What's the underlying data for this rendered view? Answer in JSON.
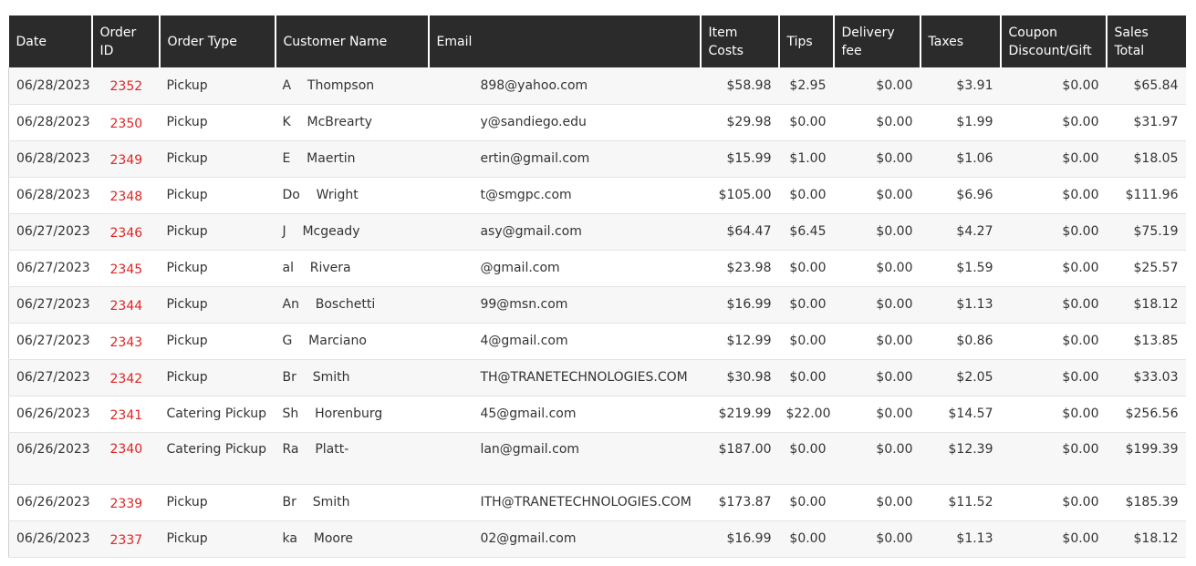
{
  "columns": [
    "Date",
    "Order ID",
    "Order Type",
    "Customer Name",
    "Email",
    "Item Costs",
    "Tips",
    "Delivery fee",
    "Taxes",
    "Coupon Discount/Gift",
    "Sales Total"
  ],
  "rows": [
    {
      "date": "06/28/2023",
      "id": "2352",
      "type": "Pickup",
      "name_a": "A",
      "name_b": "Thompson",
      "email_a": "",
      "email_b": "898@yahoo.com",
      "item": "$58.98",
      "tips": "$2.95",
      "fee": "$0.00",
      "taxes": "$3.91",
      "coupon": "$0.00",
      "total": "$65.84"
    },
    {
      "date": "06/28/2023",
      "id": "2350",
      "type": "Pickup",
      "name_a": "K",
      "name_b": "McBrearty",
      "email_a": "",
      "email_b": "y@sandiego.edu",
      "item": "$29.98",
      "tips": "$0.00",
      "fee": "$0.00",
      "taxes": "$1.99",
      "coupon": "$0.00",
      "total": "$31.97"
    },
    {
      "date": "06/28/2023",
      "id": "2349",
      "type": "Pickup",
      "name_a": "E",
      "name_b": "Maertin",
      "email_a": "",
      "email_b": "ertin@gmail.com",
      "item": "$15.99",
      "tips": "$1.00",
      "fee": "$0.00",
      "taxes": "$1.06",
      "coupon": "$0.00",
      "total": "$18.05"
    },
    {
      "date": "06/28/2023",
      "id": "2348",
      "type": "Pickup",
      "name_a": "Do",
      "name_b": "Wright",
      "email_a": "",
      "email_b": "t@smgpc.com",
      "item": "$105.00",
      "tips": "$0.00",
      "fee": "$0.00",
      "taxes": "$6.96",
      "coupon": "$0.00",
      "total": "$111.96"
    },
    {
      "date": "06/27/2023",
      "id": "2346",
      "type": "Pickup",
      "name_a": "J",
      "name_b": "Mcgeady",
      "email_a": "",
      "email_b": "asy@gmail.com",
      "item": "$64.47",
      "tips": "$6.45",
      "fee": "$0.00",
      "taxes": "$4.27",
      "coupon": "$0.00",
      "total": "$75.19"
    },
    {
      "date": "06/27/2023",
      "id": "2345",
      "type": "Pickup",
      "name_a": "al",
      "name_b": "Rivera",
      "email_a": "",
      "email_b": "@gmail.com",
      "item": "$23.98",
      "tips": "$0.00",
      "fee": "$0.00",
      "taxes": "$1.59",
      "coupon": "$0.00",
      "total": "$25.57"
    },
    {
      "date": "06/27/2023",
      "id": "2344",
      "type": "Pickup",
      "name_a": "An",
      "name_b": "Boschetti",
      "email_a": "",
      "email_b": "99@msn.com",
      "item": "$16.99",
      "tips": "$0.00",
      "fee": "$0.00",
      "taxes": "$1.13",
      "coupon": "$0.00",
      "total": "$18.12"
    },
    {
      "date": "06/27/2023",
      "id": "2343",
      "type": "Pickup",
      "name_a": "G",
      "name_b": "Marciano",
      "email_a": "",
      "email_b": "4@gmail.com",
      "item": "$12.99",
      "tips": "$0.00",
      "fee": "$0.00",
      "taxes": "$0.86",
      "coupon": "$0.00",
      "total": "$13.85"
    },
    {
      "date": "06/27/2023",
      "id": "2342",
      "type": "Pickup",
      "name_a": "Br",
      "name_b": "Smith",
      "email_a": "",
      "email_b": "TH@TRANETECHNOLOGIES.COM",
      "item": "$30.98",
      "tips": "$0.00",
      "fee": "$0.00",
      "taxes": "$2.05",
      "coupon": "$0.00",
      "total": "$33.03"
    },
    {
      "date": "06/26/2023",
      "id": "2341",
      "type": "Catering Pickup",
      "name_a": "Sh",
      "name_b": "Horenburg",
      "email_a": "",
      "email_b": "45@gmail.com",
      "item": "$219.99",
      "tips": "$22.00",
      "fee": "$0.00",
      "taxes": "$14.57",
      "coupon": "$0.00",
      "total": "$256.56"
    },
    {
      "date": "06/26/2023",
      "id": "2340",
      "type": "Catering Pickup",
      "name_a": "Ra",
      "name_b": "Platt-",
      "email_a": "",
      "email_b": "lan@gmail.com",
      "item": "$187.00",
      "tips": "$0.00",
      "fee": "$0.00",
      "taxes": "$12.39",
      "coupon": "$0.00",
      "total": "$199.39",
      "tall": true
    },
    {
      "date": "06/26/2023",
      "id": "2339",
      "type": "Pickup",
      "name_a": "Br",
      "name_b": "Smith",
      "email_a": "",
      "email_b": "ITH@TRANETECHNOLOGIES.COM",
      "item": "$173.87",
      "tips": "$0.00",
      "fee": "$0.00",
      "taxes": "$11.52",
      "coupon": "$0.00",
      "total": "$185.39"
    },
    {
      "date": "06/26/2023",
      "id": "2337",
      "type": "Pickup",
      "name_a": "ka",
      "name_b": "Moore",
      "email_a": "",
      "email_b": "02@gmail.com",
      "item": "$16.99",
      "tips": "$0.00",
      "fee": "$0.00",
      "taxes": "$1.13",
      "coupon": "$0.00",
      "total": "$18.12"
    }
  ]
}
